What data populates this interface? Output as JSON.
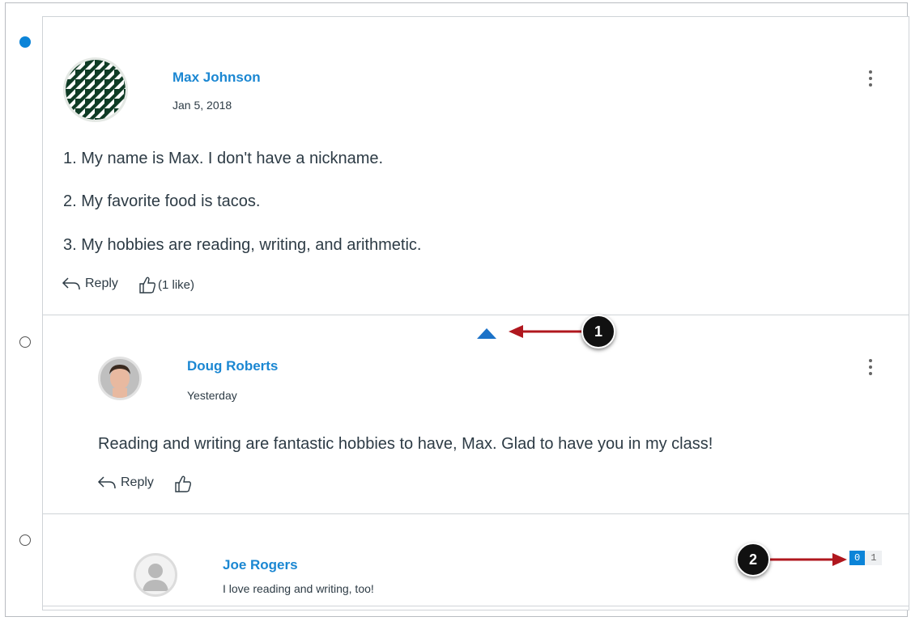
{
  "colors": {
    "link": "#1b87d2",
    "unread_dot": "#0b84d8",
    "callout_arrow": "#b0171e",
    "caret": "#1b72c8"
  },
  "entries": [
    {
      "author": "Max Johnson",
      "date": "Jan 5, 2018",
      "lines": [
        "1. My name is Max. I don't have a nickname.",
        "2. My favorite food is tacos.",
        "3. My hobbies are reading, writing, and arithmetic."
      ],
      "reply_label": "Reply",
      "like_label": "(1 like)",
      "read_state": "unread",
      "avatar_icon": "geometric-pattern-avatar"
    },
    {
      "author": "Doug Roberts",
      "date": "Yesterday",
      "text": "Reading and writing are fantastic hobbies to have, Max. Glad to have you in my class!",
      "reply_label": "Reply",
      "read_state": "read",
      "avatar_icon": "profile-photo-avatar"
    },
    {
      "author": "Joe Rogers",
      "text": "I love reading and writing, too!",
      "read_state": "read",
      "avatar_icon": "default-user-avatar",
      "unread_count": "0",
      "total_count": "1"
    }
  ],
  "callouts": [
    "1",
    "2"
  ],
  "icons": [
    "collapse-caret-icon",
    "reply-arrow-icon",
    "thumbs-up-icon",
    "kebab-menu-icon"
  ]
}
